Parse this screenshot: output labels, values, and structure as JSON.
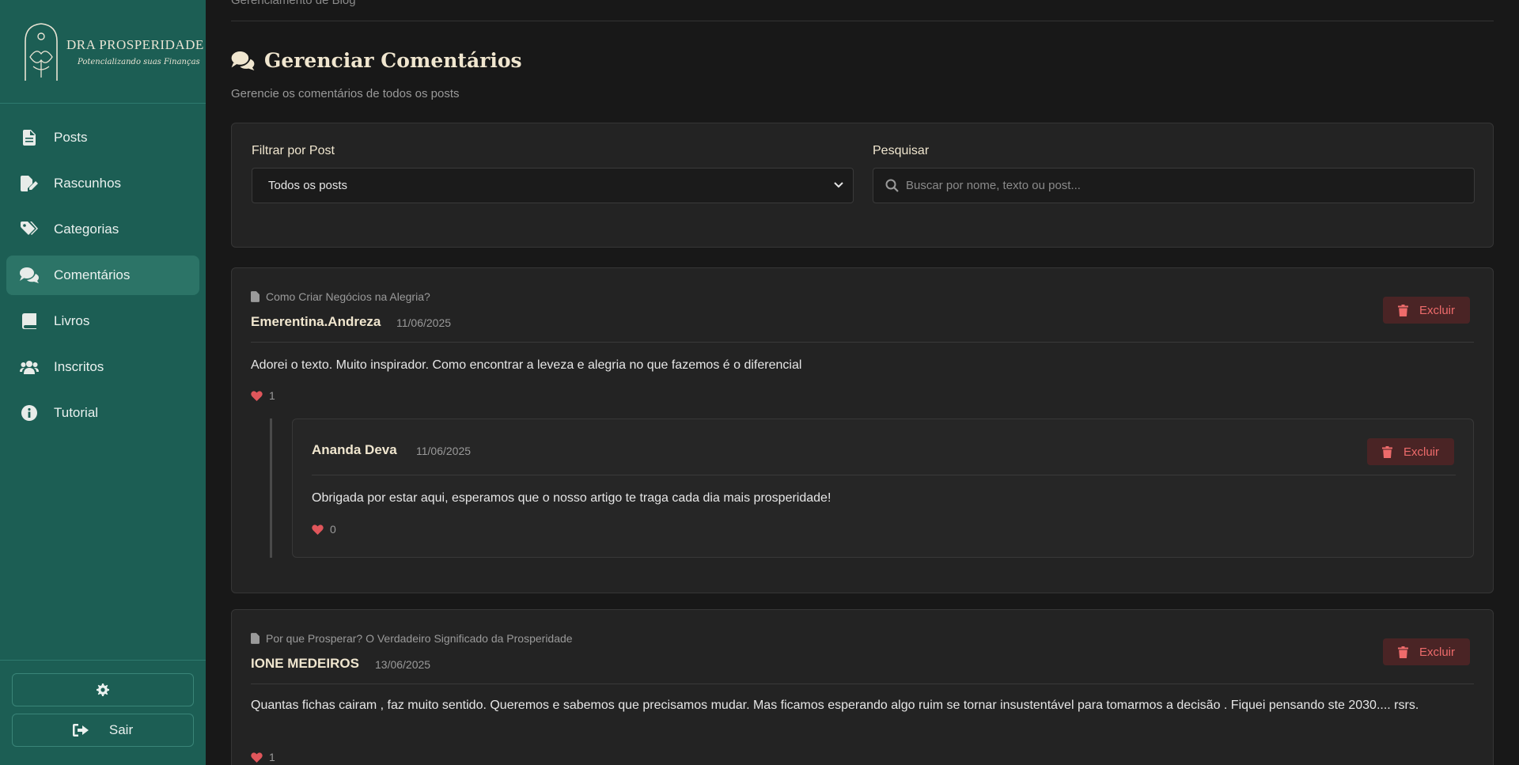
{
  "brand": {
    "name": "DRA PROSPERIDADE",
    "tagline": "Potencializando suas Finanças"
  },
  "sidebar": {
    "items": [
      {
        "label": "Posts",
        "icon": "file-icon"
      },
      {
        "label": "Rascunhos",
        "icon": "file-edit-icon"
      },
      {
        "label": "Categorias",
        "icon": "tags-icon"
      },
      {
        "label": "Comentários",
        "icon": "comments-icon",
        "active": true
      },
      {
        "label": "Livros",
        "icon": "book-icon"
      },
      {
        "label": "Inscritos",
        "icon": "users-icon"
      },
      {
        "label": "Tutorial",
        "icon": "info-icon"
      }
    ],
    "settings_icon": "gear-icon",
    "logout_label": "Sair"
  },
  "header": {
    "breadcrumb": "Gerenciamento de Blog",
    "title": "Gerenciar Comentários",
    "subtitle": "Gerencie os comentários de todos os posts"
  },
  "filters": {
    "post_label": "Filtrar por Post",
    "post_selected": "Todos os posts",
    "search_label": "Pesquisar",
    "search_placeholder": "Buscar por nome, texto ou post...",
    "search_value": ""
  },
  "comments": [
    {
      "post_title": "Como Criar Negócios na Alegria?",
      "author": "Emerentina.Andreza",
      "date": "11/06/2025",
      "text": "Adorei o texto. Muito inspirador. Como encontrar a leveza e alegria no que fazemos é o diferencial",
      "likes": "1",
      "delete_label": "Excluir",
      "replies": [
        {
          "author": "Ananda Deva",
          "date": "11/06/2025",
          "text": "Obrigada por estar aqui, esperamos que o nosso artigo te traga cada dia mais prosperidade!",
          "likes": "0",
          "delete_label": "Excluir"
        }
      ]
    },
    {
      "post_title": "Por que Prosperar? O Verdadeiro Significado da Prosperidade",
      "author": "IONE MEDEIROS",
      "date": "13/06/2025",
      "text": "Quantas fichas cairam , faz muito sentido. Queremos e sabemos que precisamos mudar. Mas ficamos esperando algo ruim se tornar insustentável para tomarmos a decisão . Fiquei pensando ste 2030.... rsrs.",
      "likes": "1",
      "delete_label": "Excluir",
      "replies": []
    }
  ],
  "colors": {
    "sidebar_bg": "#1c5e54",
    "accent_text": "#f0e6cf",
    "danger": "#ee6b6b",
    "background": "#181818"
  }
}
